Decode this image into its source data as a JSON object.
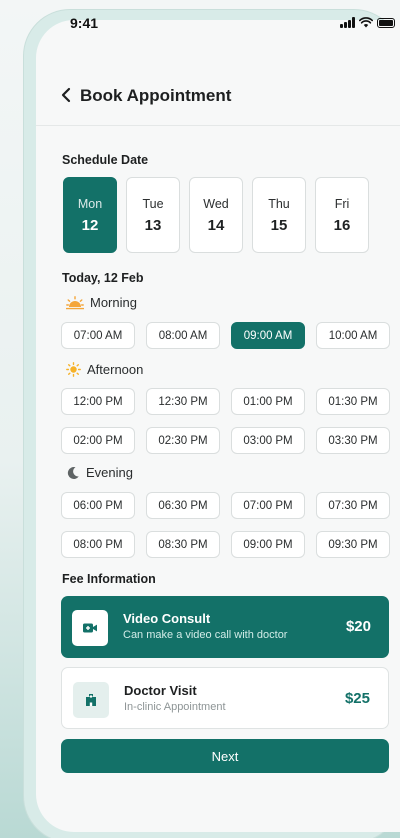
{
  "status_bar": {
    "time": "9:41"
  },
  "header": {
    "title": "Book Appointment"
  },
  "schedule": {
    "label": "Schedule Date",
    "days": [
      {
        "name": "Mon",
        "date": "12",
        "selected": true
      },
      {
        "name": "Tue",
        "date": "13",
        "selected": false
      },
      {
        "name": "Wed",
        "date": "14",
        "selected": false
      },
      {
        "name": "Thu",
        "date": "15",
        "selected": false
      },
      {
        "name": "Fri",
        "date": "16",
        "selected": false
      }
    ],
    "today_label": "Today, 12 Feb"
  },
  "periods": {
    "morning": {
      "label": "Morning",
      "icon": "sunrise-icon",
      "slots": [
        "07:00 AM",
        "08:00 AM",
        "09:00 AM",
        "10:00 AM"
      ],
      "selected": "09:00 AM"
    },
    "afternoon": {
      "label": "Afternoon",
      "icon": "sun-icon",
      "slots": [
        "12:00 PM",
        "12:30 PM",
        "01:00 PM",
        "01:30 PM",
        "02:00 PM",
        "02:30 PM",
        "03:00 PM",
        "03:30 PM"
      ]
    },
    "evening": {
      "label": "Evening",
      "icon": "moon-icon",
      "slots": [
        "06:00 PM",
        "06:30 PM",
        "07:00 PM",
        "07:30 PM",
        "08:00 PM",
        "08:30 PM",
        "09:00 PM",
        "09:30 PM"
      ]
    }
  },
  "fee": {
    "label": "Fee Information",
    "options": [
      {
        "title": "Video Consult",
        "subtitle": "Can make a video call with doctor",
        "price": "$20",
        "icon": "video-camera-icon",
        "selected": true
      },
      {
        "title": "Doctor Visit",
        "subtitle": "In-clinic Appointment",
        "price": "$25",
        "icon": "hospital-icon",
        "selected": false
      }
    ]
  },
  "next_button": {
    "label": "Next"
  },
  "colors": {
    "accent": "#137168",
    "background": "#f7f8f8"
  }
}
